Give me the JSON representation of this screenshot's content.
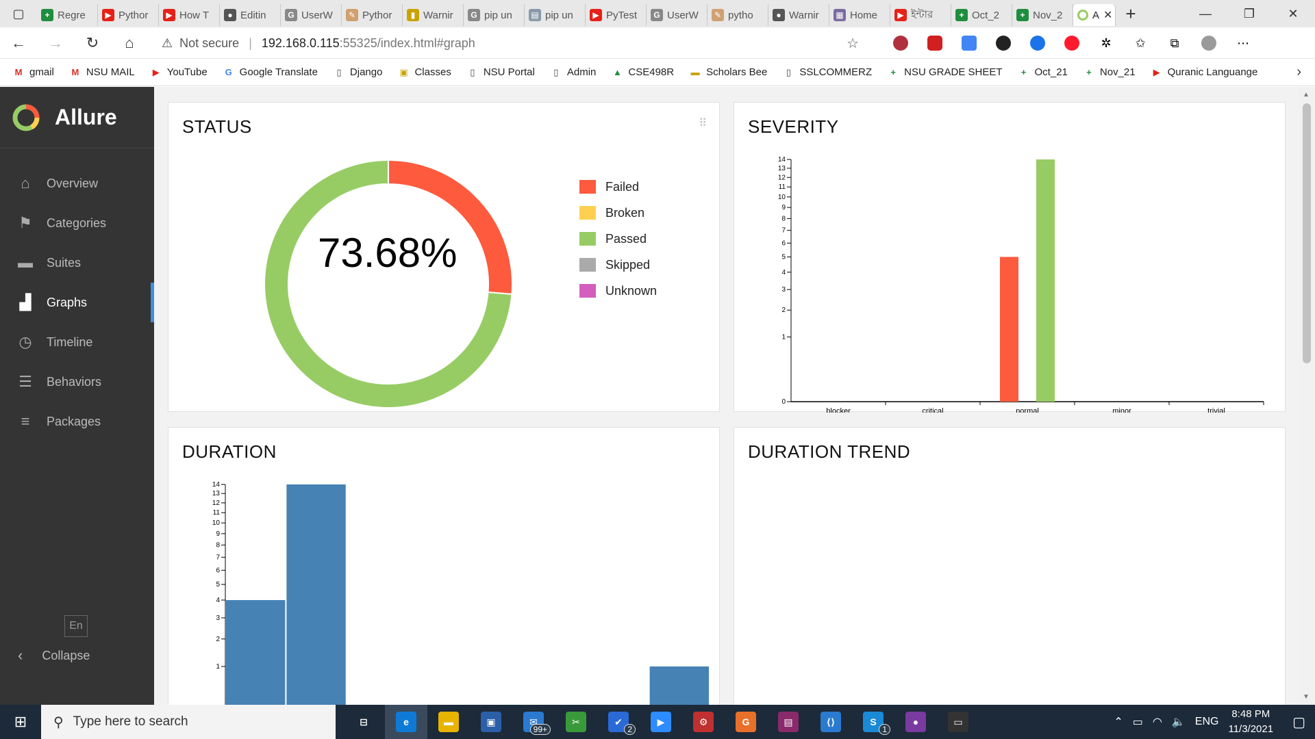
{
  "browser": {
    "tabs": [
      {
        "label": "Regre",
        "color": "#1e8e3e",
        "glyph": "+"
      },
      {
        "label": "Pythor",
        "color": "#e62117",
        "glyph": "▶"
      },
      {
        "label": "How T",
        "color": "#e62117",
        "glyph": "▶"
      },
      {
        "label": "Editin",
        "color": "#555555",
        "glyph": "●"
      },
      {
        "label": "UserW",
        "color": "#888888",
        "glyph": "G"
      },
      {
        "label": "Pythor",
        "color": "#d0a070",
        "glyph": "✎"
      },
      {
        "label": "Warnir",
        "color": "#c9a400",
        "glyph": "▮"
      },
      {
        "label": "pip un",
        "color": "#888888",
        "glyph": "G"
      },
      {
        "label": "pip un",
        "color": "#8899aa",
        "glyph": "▤"
      },
      {
        "label": "PyTest",
        "color": "#e62117",
        "glyph": "▶"
      },
      {
        "label": "UserW",
        "color": "#888888",
        "glyph": "G"
      },
      {
        "label": "pytho",
        "color": "#d0a070",
        "glyph": "✎"
      },
      {
        "label": "Warnir",
        "color": "#555555",
        "glyph": "●"
      },
      {
        "label": "Home",
        "color": "#7a6aa0",
        "glyph": "▦"
      },
      {
        "label": "ইন্টার",
        "color": "#e62117",
        "glyph": "▶"
      },
      {
        "label": "Oct_2",
        "color": "#1e8e3e",
        "glyph": "+"
      },
      {
        "label": "Nov_2",
        "color": "#1e8e3e",
        "glyph": "+"
      }
    ],
    "active_tab": {
      "label": "A"
    },
    "url": {
      "security": "Not secure",
      "host": "192.168.0.115",
      "rest": ":55325/index.html#graph"
    },
    "bookmarks": [
      {
        "label": "gmail",
        "glyph": "M",
        "color": "#d93025"
      },
      {
        "label": "NSU MAIL",
        "glyph": "M",
        "color": "#d93025"
      },
      {
        "label": "YouTube",
        "glyph": "▶",
        "color": "#e62117"
      },
      {
        "label": "Google Translate",
        "glyph": "G",
        "color": "#4285f4"
      },
      {
        "label": "Django",
        "glyph": "▯",
        "color": "#444444"
      },
      {
        "label": "Classes",
        "glyph": "▣",
        "color": "#c9a400"
      },
      {
        "label": "NSU Portal",
        "glyph": "▯",
        "color": "#444444"
      },
      {
        "label": "Admin",
        "glyph": "▯",
        "color": "#444444"
      },
      {
        "label": "CSE498R",
        "glyph": "▲",
        "color": "#1e8e3e"
      },
      {
        "label": "Scholars Bee",
        "glyph": "▬",
        "color": "#c9a400"
      },
      {
        "label": "SSLCOMMERZ",
        "glyph": "▯",
        "color": "#444444"
      },
      {
        "label": "NSU GRADE SHEET",
        "glyph": "+",
        "color": "#1e8e3e"
      },
      {
        "label": "Oct_21",
        "glyph": "+",
        "color": "#1e8e3e"
      },
      {
        "label": "Nov_21",
        "glyph": "+",
        "color": "#1e8e3e"
      },
      {
        "label": "Quranic Languange",
        "glyph": "▶",
        "color": "#e62117"
      }
    ]
  },
  "sidebar": {
    "brand": "Allure",
    "items": [
      {
        "label": "Overview",
        "icon": "home-icon",
        "glyph": "⌂"
      },
      {
        "label": "Categories",
        "icon": "flag-icon",
        "glyph": "⚑"
      },
      {
        "label": "Suites",
        "icon": "briefcase-icon",
        "glyph": "▬"
      },
      {
        "label": "Graphs",
        "icon": "bar-chart-icon",
        "glyph": "▟"
      },
      {
        "label": "Timeline",
        "icon": "clock-icon",
        "glyph": "◷"
      },
      {
        "label": "Behaviors",
        "icon": "list-icon",
        "glyph": "☰"
      },
      {
        "label": "Packages",
        "icon": "align-left-icon",
        "glyph": "≡"
      }
    ],
    "active_index": 3,
    "language": "En",
    "collapse": "Collapse"
  },
  "cards": {
    "status": {
      "title": "STATUS"
    },
    "severity": {
      "title": "SEVERITY"
    },
    "duration": {
      "title": "DURATION"
    },
    "duration_trend": {
      "title": "DURATION TREND"
    }
  },
  "chart_data": [
    {
      "type": "pie",
      "title": "STATUS",
      "center_label": "73.68%",
      "slices": [
        {
          "name": "Failed",
          "value": 5,
          "color": "#fd5a3e"
        },
        {
          "name": "Broken",
          "value": 0,
          "color": "#ffd050"
        },
        {
          "name": "Passed",
          "value": 14,
          "color": "#97cc64"
        },
        {
          "name": "Skipped",
          "value": 0,
          "color": "#aaaaaa"
        },
        {
          "name": "Unknown",
          "value": 0,
          "color": "#d35ebe"
        }
      ]
    },
    {
      "type": "bar",
      "title": "SEVERITY",
      "categories": [
        "blocker",
        "critical",
        "normal",
        "minor",
        "trivial"
      ],
      "series": [
        {
          "name": "Failed",
          "color": "#fd5a3e",
          "values": [
            0,
            0,
            5,
            0,
            0
          ]
        },
        {
          "name": "Passed",
          "color": "#97cc64",
          "values": [
            0,
            0,
            14,
            0,
            0
          ]
        }
      ],
      "yscale": "sqrt",
      "yticks": [
        0,
        1,
        2,
        3,
        4,
        5,
        6,
        7,
        8,
        9,
        10,
        11,
        12,
        13,
        14
      ],
      "ylim": [
        0,
        14
      ]
    },
    {
      "type": "bar",
      "title": "DURATION",
      "bins": 8,
      "values": [
        4,
        14,
        0,
        0,
        0,
        0,
        0,
        1
      ],
      "color": "#4682b4",
      "yscale": "sqrt",
      "yticks": [
        1,
        2,
        3,
        4,
        5,
        6,
        7,
        8,
        9,
        10,
        11,
        12,
        13,
        14
      ],
      "ylim": [
        0,
        14
      ]
    }
  ],
  "taskbar": {
    "search_placeholder": "Type here to search",
    "apps": [
      {
        "name": "task-view",
        "glyph": "⊟",
        "color": "transparent"
      },
      {
        "name": "edge",
        "glyph": "e",
        "color": "#0f7ad6"
      },
      {
        "name": "file-explorer",
        "glyph": "▬",
        "color": "#e8b400"
      },
      {
        "name": "store",
        "glyph": "▣",
        "color": "#2b5fa8"
      },
      {
        "name": "mail",
        "glyph": "✉",
        "color": "#2a7ad0",
        "badge": "99+"
      },
      {
        "name": "snip",
        "glyph": "✂",
        "color": "#3a9a3a"
      },
      {
        "name": "todo",
        "glyph": "✔",
        "color": "#2a6ad6",
        "badge": "2"
      },
      {
        "name": "zoom",
        "glyph": "▶",
        "color": "#2d8cff"
      },
      {
        "name": "git-tool",
        "glyph": "⚙",
        "color": "#c03030"
      },
      {
        "name": "powerpoint",
        "glyph": "G",
        "color": "#e8702a"
      },
      {
        "name": "winrar",
        "glyph": "▤",
        "color": "#8a2a6a"
      },
      {
        "name": "vscode",
        "glyph": "⟨⟩",
        "color": "#2a7ad0"
      },
      {
        "name": "skype",
        "glyph": "S",
        "color": "#1a8ad6",
        "badge": "1"
      },
      {
        "name": "github",
        "glyph": "●",
        "color": "#7a3aa0"
      },
      {
        "name": "terminal",
        "glyph": "▭",
        "color": "#333333"
      }
    ],
    "lang": "ENG",
    "time": "8:48 PM",
    "date": "11/3/2021"
  }
}
